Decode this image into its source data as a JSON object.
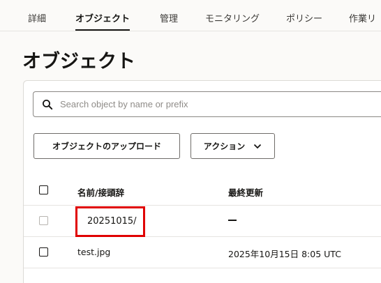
{
  "tabs": [
    {
      "label": "詳細"
    },
    {
      "label": "オブジェクト",
      "active": true
    },
    {
      "label": "管理"
    },
    {
      "label": "モニタリング"
    },
    {
      "label": "ポリシー"
    },
    {
      "label": "作業リ"
    }
  ],
  "page": {
    "title": "オブジェクト"
  },
  "search": {
    "icon": "search-icon",
    "placeholder": "Search object by name or prefix",
    "value": ""
  },
  "toolbar": {
    "upload_label": "オブジェクトのアップロード",
    "action_label": "アクション",
    "action_icon": "chevron-down-icon"
  },
  "table": {
    "columns": [
      "名前/接頭辞",
      "最終更新"
    ],
    "rows": [
      {
        "name": "20251015/",
        "modified": "—",
        "is_folder": true,
        "highlight_color": "#e00000"
      },
      {
        "name": "test.jpg",
        "modified": "2025年10月15日 8:05 UTC",
        "is_folder": false
      }
    ]
  }
}
